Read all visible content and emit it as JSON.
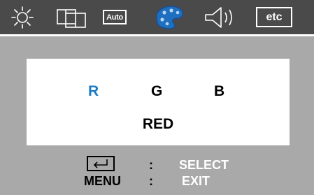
{
  "menu_bar": {
    "items": [
      {
        "name": "brightness",
        "icon": "sun-icon"
      },
      {
        "name": "position",
        "icon": "screen-position-icon"
      },
      {
        "name": "auto",
        "label": "Auto"
      },
      {
        "name": "color",
        "icon": "color-palette-icon",
        "selected": true
      },
      {
        "name": "volume",
        "icon": "speaker-icon"
      },
      {
        "name": "etc",
        "label": "etc"
      }
    ]
  },
  "color_panel": {
    "channels": {
      "r": "R",
      "g": "G",
      "b": "B"
    },
    "selected_channel": "R",
    "selected_color_name": "RED"
  },
  "help": {
    "enter_icon": "enter-key-icon",
    "colon": ":",
    "select_label": "SELECT",
    "menu_label": "MENU",
    "exit_label": "EXIT"
  },
  "colors": {
    "top_bar": "#4a4a4a",
    "background": "#a9a9a9",
    "accent": "#1c7bc4",
    "palette_icon": "#1f6fc0"
  }
}
